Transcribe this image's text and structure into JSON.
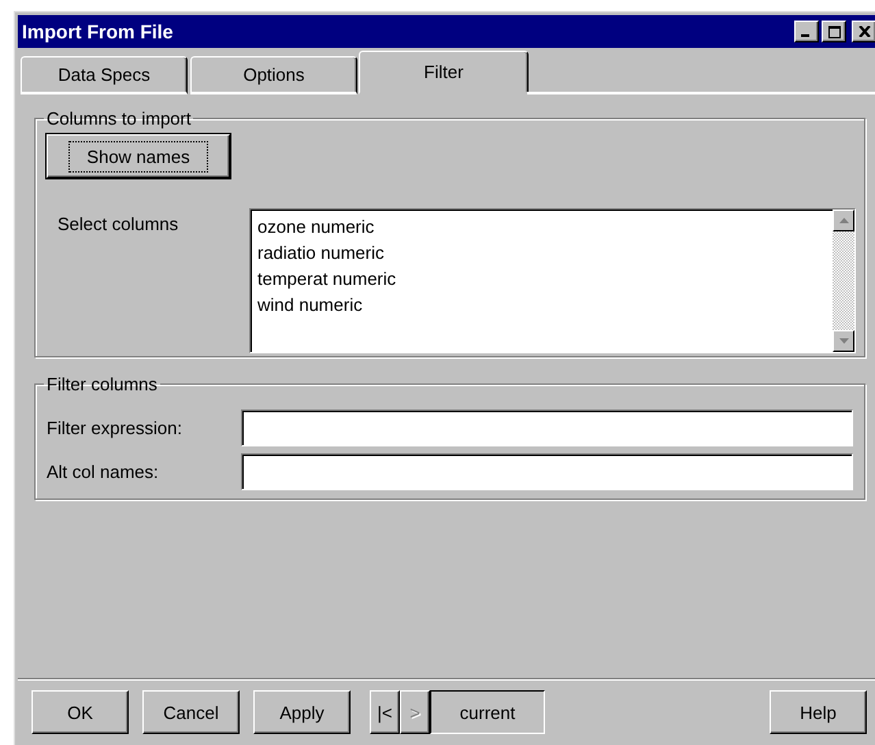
{
  "window": {
    "title": "Import From File"
  },
  "tabs": [
    {
      "label": "Data Specs",
      "selected": false
    },
    {
      "label": "Options",
      "selected": false
    },
    {
      "label": "Filter",
      "selected": true
    }
  ],
  "columns_group": {
    "title": "Columns to import",
    "show_names_button": "Show names",
    "select_label": "Select columns",
    "columns": [
      "ozone numeric",
      "radiatio numeric",
      "temperat numeric",
      "wind numeric"
    ]
  },
  "filter_group": {
    "title": "Filter columns",
    "fields": [
      {
        "label": "Filter expression:"
      },
      {
        "label": "Alt col names:"
      }
    ]
  },
  "buttons": [
    {
      "label": "OK"
    },
    {
      "label": "Cancel"
    },
    {
      "label": "Apply"
    }
  ],
  "navigator": {
    "first": {
      "label": "|<",
      "disabled": false
    },
    "next": {
      "label": ">",
      "disabled": true
    },
    "current": "current"
  },
  "help_button": "Help"
}
